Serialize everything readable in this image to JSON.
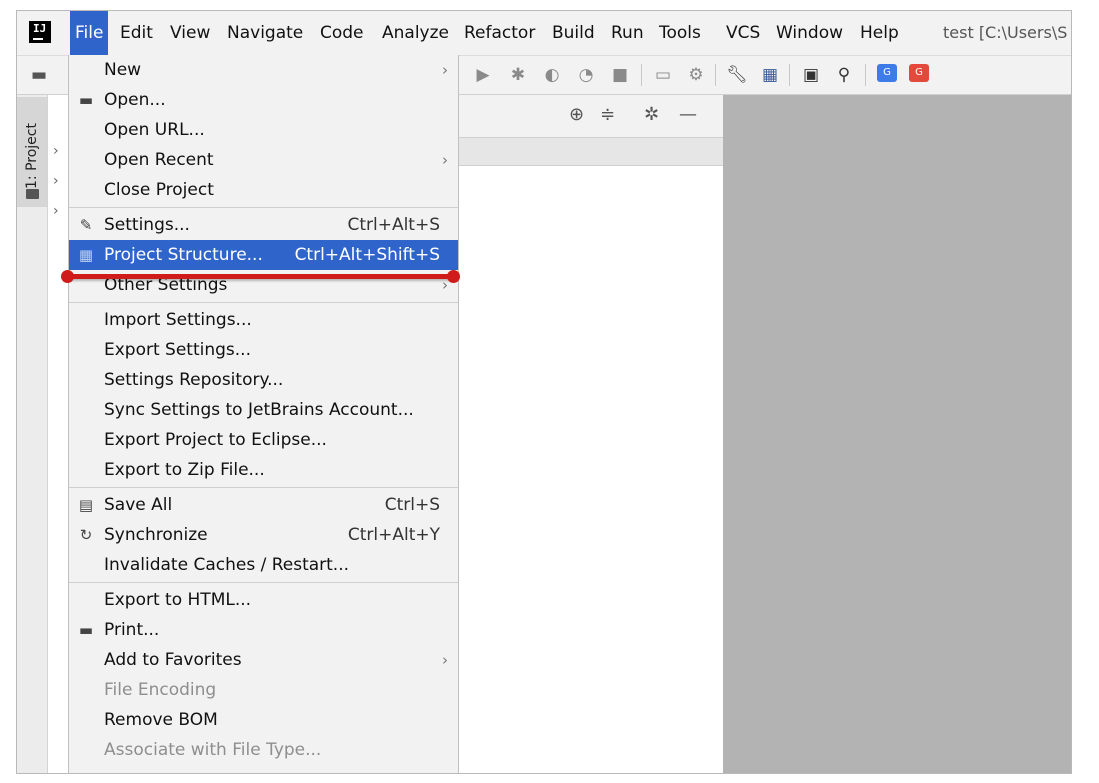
{
  "menubar": {
    "items": [
      {
        "label": "File",
        "active": true
      },
      {
        "label": "Edit"
      },
      {
        "label": "View"
      },
      {
        "label": "Navigate"
      },
      {
        "label": "Code"
      },
      {
        "label": "Analyze"
      },
      {
        "label": "Refactor"
      },
      {
        "label": "Build"
      },
      {
        "label": "Run"
      },
      {
        "label": "Tools"
      },
      {
        "label": "VCS"
      },
      {
        "label": "Window"
      },
      {
        "label": "Help"
      }
    ],
    "window_title": "test [C:\\Users\\S"
  },
  "app_icon": {
    "glyph": "IJ",
    "icon": "intellij-logo"
  },
  "sidebar": {
    "project_tab_label": "1: Project"
  },
  "file_menu": {
    "items": [
      {
        "label": "New",
        "submenu": true
      },
      {
        "label": "Open...",
        "icon": "folder-open-icon"
      },
      {
        "label": "Open URL..."
      },
      {
        "label": "Open Recent",
        "submenu": true
      },
      {
        "label": "Close Project"
      },
      {
        "label": "Settings...",
        "shortcut": "Ctrl+Alt+S",
        "icon": "wrench-icon"
      },
      {
        "label": "Project Structure...",
        "shortcut": "Ctrl+Alt+Shift+S",
        "icon": "project-structure-icon",
        "selected": true
      },
      {
        "label": "Other Settings",
        "submenu": true
      },
      {
        "label": "Import Settings..."
      },
      {
        "label": "Export Settings..."
      },
      {
        "label": "Settings Repository..."
      },
      {
        "label": "Sync Settings to JetBrains Account..."
      },
      {
        "label": "Export Project to Eclipse..."
      },
      {
        "label": "Export to Zip File..."
      },
      {
        "label": "Save All",
        "shortcut": "Ctrl+S",
        "icon": "save-icon"
      },
      {
        "label": "Synchronize",
        "shortcut": "Ctrl+Alt+Y",
        "icon": "sync-icon"
      },
      {
        "label": "Invalidate Caches / Restart..."
      },
      {
        "label": "Export to HTML..."
      },
      {
        "label": "Print...",
        "icon": "printer-icon"
      },
      {
        "label": "Add to Favorites",
        "submenu": true
      },
      {
        "label": "File Encoding",
        "disabled": true
      },
      {
        "label": "Remove BOM"
      },
      {
        "label": "Associate with File Type...",
        "disabled": true
      }
    ]
  },
  "colors": {
    "selection": "#2f65ca",
    "annotation": "#d01b1b",
    "editor_bg": "#b3b3b3"
  }
}
